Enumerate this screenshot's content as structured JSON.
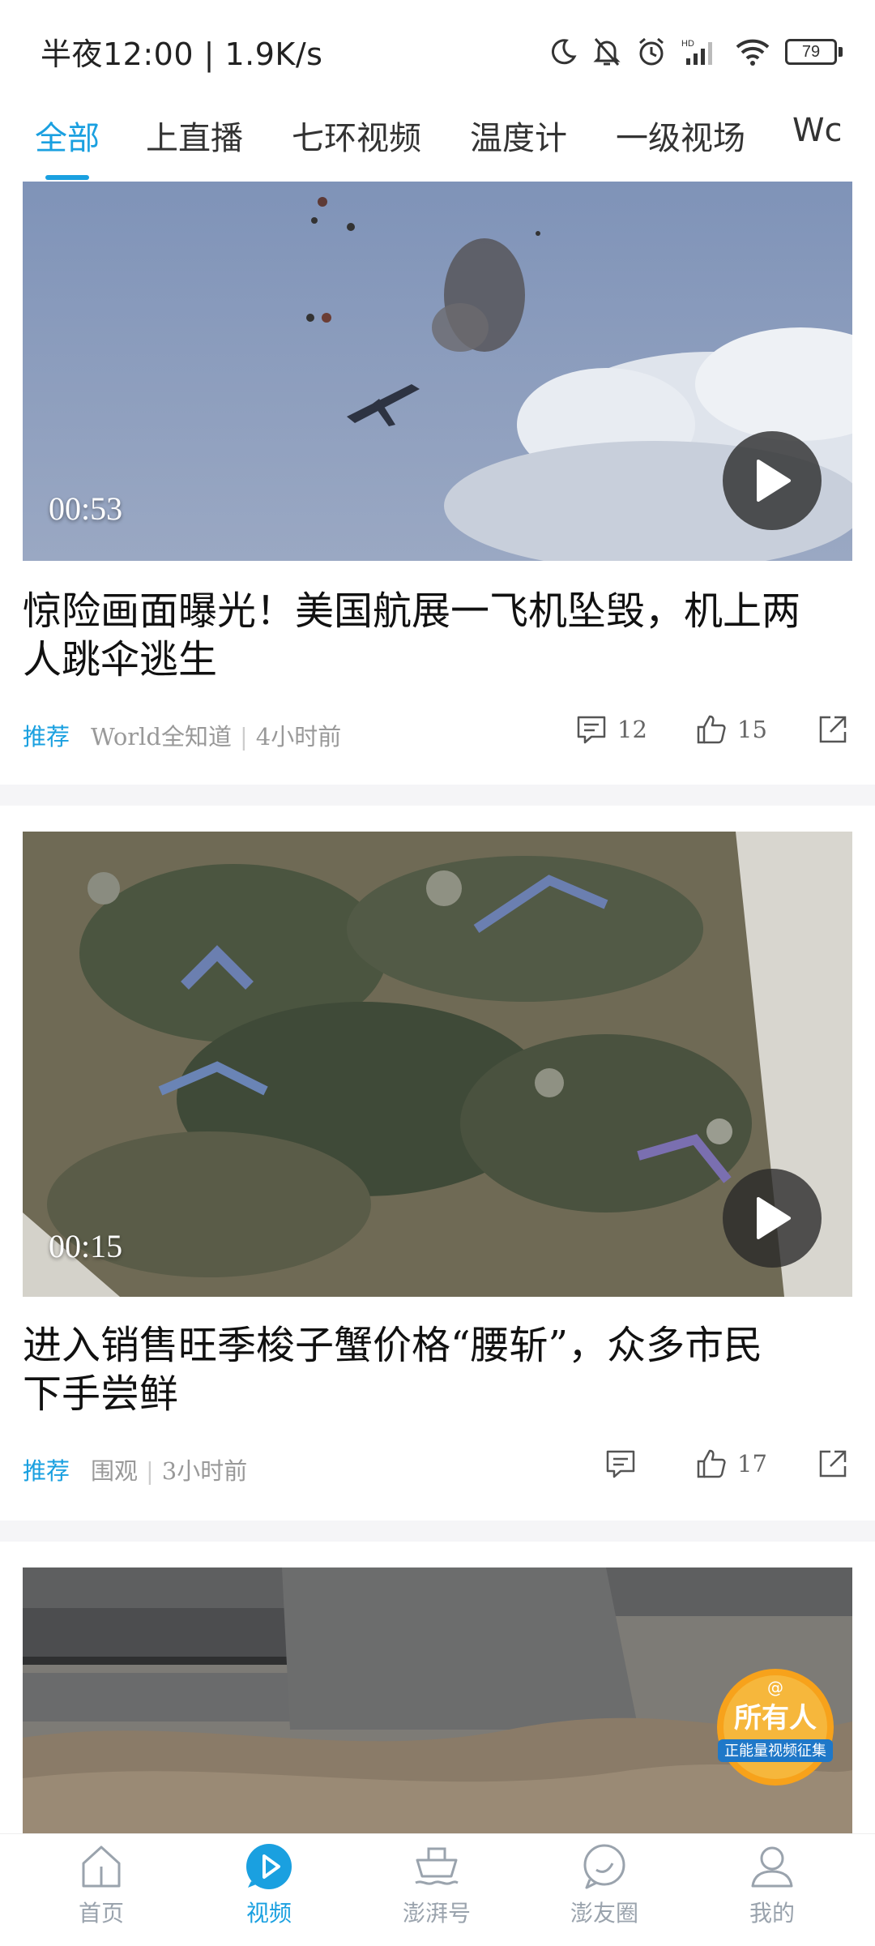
{
  "status_bar": {
    "time_speed": "半夜12:00 | 1.9K/s",
    "battery": "79",
    "network": "HD"
  },
  "tabs": [
    {
      "label": "全部",
      "active": true
    },
    {
      "label": "上直播"
    },
    {
      "label": "七环视频"
    },
    {
      "label": "温度计"
    },
    {
      "label": "一级视场"
    },
    {
      "label": "Wc"
    }
  ],
  "videos": [
    {
      "duration": "00:53",
      "title_line1": "惊险画面曝光！美国航展一飞机坠毁，机上两",
      "title_line2": "人跳伞逃生",
      "tag": "推荐",
      "source": "World全知道",
      "time": "4小时前",
      "comments": "12",
      "likes": "15"
    },
    {
      "duration": "00:15",
      "title_line1": "进入销售旺季梭子蟹价格“腰斩”，众多市民",
      "title_line2": "下手尝鲜",
      "tag": "推荐",
      "source": "围观",
      "time": "3小时前",
      "comments": "",
      "likes": "17"
    }
  ],
  "badge": {
    "line1": "所有人",
    "line2": "正能量视频征集"
  },
  "bottom_nav": [
    {
      "label": "首页",
      "icon": "home-icon"
    },
    {
      "label": "视频",
      "icon": "video-play-icon",
      "active": true
    },
    {
      "label": "澎湃号",
      "icon": "ship-icon"
    },
    {
      "label": "澎友圈",
      "icon": "chat-bubble-icon"
    },
    {
      "label": "我的",
      "icon": "user-icon"
    }
  ],
  "colors": {
    "accent": "#1aa0e0",
    "muted": "#999999",
    "badge_orange": "#f7a21b"
  }
}
